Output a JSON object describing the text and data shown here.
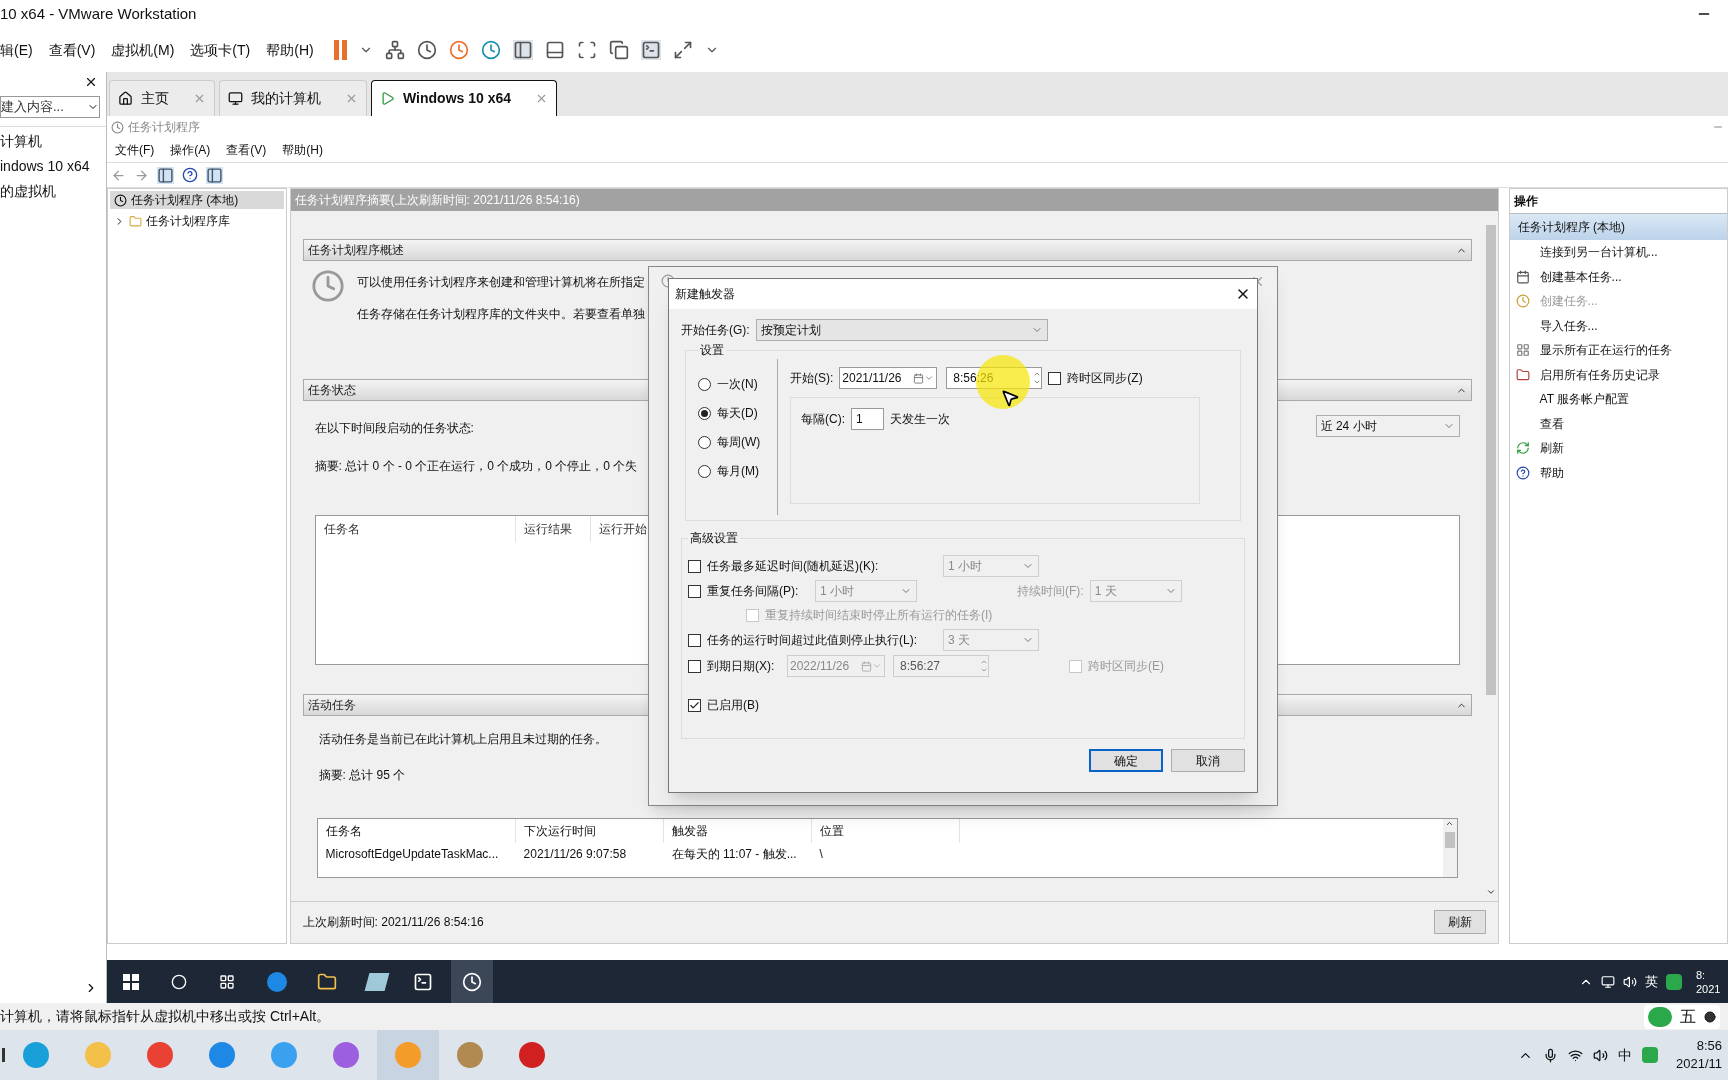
{
  "window": {
    "title": "10 x64 - VMware Workstation"
  },
  "menu": [
    "辑(E)",
    "查看(V)",
    "虚拟机(M)",
    "选项卡(T)",
    "帮助(H)"
  ],
  "library": {
    "search": {
      "placeholder": "建入内容..."
    },
    "items": [
      {
        "label": "计算机"
      },
      {
        "label": "indows 10 x64"
      },
      {
        "label": "的虚拟机"
      }
    ]
  },
  "tabs": [
    {
      "label": "主页",
      "kind": "home",
      "selected": false
    },
    {
      "label": "我的计算机",
      "kind": "computer",
      "selected": false
    },
    {
      "label": "Windows 10 x64",
      "kind": "vm",
      "selected": true
    }
  ],
  "guest_window": {
    "title": "任务计划程序",
    "menu": [
      "文件(F)",
      "操作(A)",
      "查看(V)",
      "帮助(H)"
    ],
    "tree": [
      {
        "label": "任务计划程序 (本地)",
        "selected": true,
        "children": [
          {
            "label": "任务计划程序库",
            "selected": false,
            "expanded": false
          }
        ]
      }
    ],
    "summary_header": "任务计划程序摘要(上次刷新时间: 2021/11/26 8:54:16)",
    "overview": {
      "title": "任务计划程序概述",
      "expanded": true,
      "lines": [
        "可以使用任务计划程序来创建和管理计算机将在所指定",
        "任务存储在任务计划程序库的文件夹中。若要查看单独"
      ]
    },
    "status": {
      "title": "任务状态",
      "expanded": true,
      "intro": "在以下时间段启动的任务状态:",
      "summary": "摘要: 总计 0 个 - 0 个正在运行，0 个成功，0 个停止，0 个失",
      "period": "近 24 小时",
      "table": {
        "columns": [
          "任务名",
          "运行结果",
          "运行开始"
        ]
      }
    },
    "active": {
      "title": "活动任务",
      "expanded": true,
      "intro": "活动任务是当前已在此计算机上启用且未过期的任务。",
      "summary": "摘要: 总计 95 个",
      "table": {
        "columns": [
          "任务名",
          "下次运行时间",
          "触发器",
          "位置"
        ],
        "rows": [
          [
            "MicrosoftEdgeUpdateTaskMac...",
            "2021/11/26 9:07:58",
            "在每天的 11:07 - 触发...",
            "\\"
          ]
        ]
      }
    },
    "footer": {
      "text": "上次刷新时间: 2021/11/26 8:54:16",
      "button": "刷新"
    },
    "actions": {
      "title": "操作",
      "scope": {
        "label": "任务计划程序 (本地)",
        "selected": true
      },
      "items": [
        {
          "label": "连接到另一台计算机...",
          "kind": "plain",
          "disabled": false
        },
        {
          "label": "创建基本任务...",
          "kind": "basic",
          "disabled": false
        },
        {
          "label": "创建任务...",
          "kind": "create",
          "disabled": true
        },
        {
          "label": "导入任务...",
          "kind": "plain",
          "disabled": false
        },
        {
          "label": "显示所有正在运行的任务",
          "kind": "running",
          "disabled": false
        },
        {
          "label": "启用所有任务历史记录",
          "kind": "history",
          "disabled": false
        },
        {
          "label": "AT 服务帐户配置",
          "kind": "plain",
          "disabled": false
        },
        {
          "label": "查看",
          "kind": "plain",
          "disabled": false
        },
        {
          "label": "刷新",
          "kind": "refresh",
          "disabled": false
        },
        {
          "label": "帮助",
          "kind": "help",
          "disabled": false
        }
      ]
    }
  },
  "dialog": {
    "title": "新建触发器",
    "begin_label": "开始任务(G):",
    "begin_value": "按预定计划",
    "settings_title": "设置",
    "schedules": [
      {
        "label": "一次(N)",
        "selected": false
      },
      {
        "label": "每天(D)",
        "selected": true
      },
      {
        "label": "每周(W)",
        "selected": false
      },
      {
        "label": "每月(M)",
        "selected": false
      }
    ],
    "start_label": "开始(S):",
    "start_date": "2021/11/26",
    "start_time": "8:56:26",
    "sync": {
      "label": "跨时区同步(Z)",
      "checked": false
    },
    "recur_label": "每隔(C):",
    "recur_value": "1",
    "recur_unit": "天发生一次",
    "advanced_title": "高级设置",
    "delay": {
      "label": "任务最多延迟时间(随机延迟)(K):",
      "checked": false,
      "value": "1 小时"
    },
    "repeat": {
      "label": "重复任务间隔(P):",
      "checked": false,
      "value": "1 小时",
      "duration_label": "持续时间(F):",
      "duration_value": "1 天"
    },
    "stop_all": {
      "label": "重复持续时间结束时停止所有运行的任务(I)",
      "checked": false,
      "disabled": true
    },
    "stop_after": {
      "label": "任务的运行时间超过此值则停止执行(L):",
      "checked": false,
      "value": "3 天"
    },
    "expire": {
      "label": "到期日期(X):",
      "checked": false,
      "date": "2022/11/26",
      "time": "8:56:27",
      "sync_label": "跨时区同步(E)",
      "sync_checked": false
    },
    "enabled": {
      "label": "已启用(B)",
      "checked": true
    },
    "buttons": [
      {
        "label": "确定",
        "focused": true
      },
      {
        "label": "取消",
        "focused": false
      }
    ]
  },
  "guest_taskbar": {
    "tray_ime": "英",
    "clock_time": "8:",
    "clock_date": "2021"
  },
  "status_bar": {
    "text": "计算机，请将鼠标指针从虚拟机中移出或按 Ctrl+Alt。"
  },
  "ime_bar": {
    "mode": "五"
  },
  "host_taskbar": {
    "tray_ime": "中",
    "clock_time": "8:56",
    "clock_date": "2021/11"
  }
}
